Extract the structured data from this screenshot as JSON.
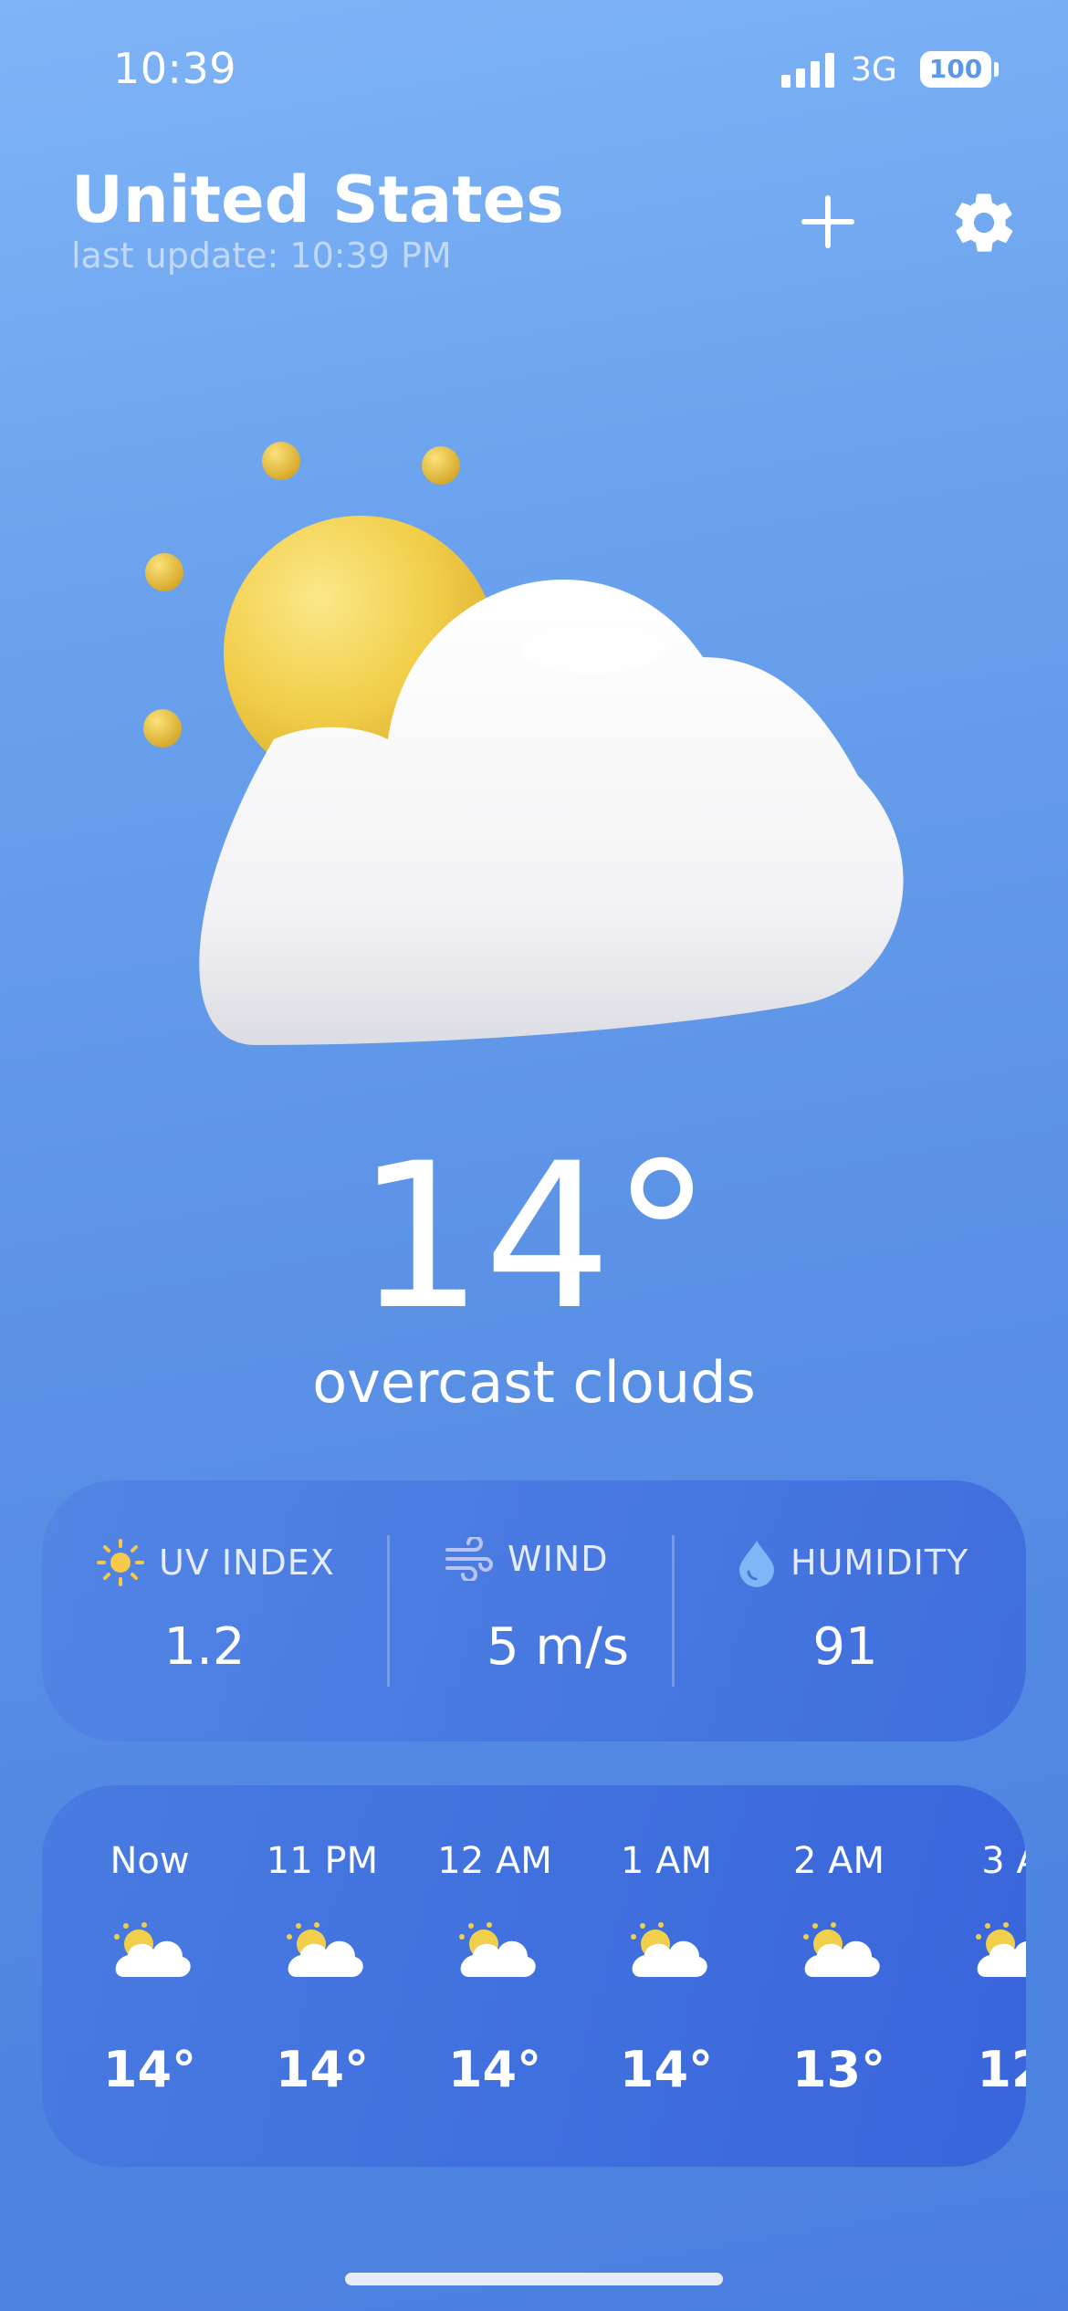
{
  "status_bar": {
    "time": "10:39",
    "network": "3G",
    "battery": "100"
  },
  "header": {
    "location": "United States",
    "last_update": "last update: 10:39 PM",
    "add_icon": "plus-icon",
    "settings_icon": "gear-icon"
  },
  "current": {
    "illustration": "sun-behind-cloud",
    "temperature": "14°",
    "condition": "overcast clouds"
  },
  "stats": [
    {
      "icon": "sun-icon",
      "label": "UV INDEX",
      "value": "1.2"
    },
    {
      "icon": "wind-icon",
      "label": "WIND",
      "value": "5 m/s"
    },
    {
      "icon": "drop-icon",
      "label": "HUMIDITY",
      "value": "91"
    }
  ],
  "hourly": [
    {
      "time": "Now",
      "icon": "partly-cloudy-icon",
      "temp": "14°"
    },
    {
      "time": "11 PM",
      "icon": "partly-cloudy-icon",
      "temp": "14°"
    },
    {
      "time": "12 AM",
      "icon": "partly-cloudy-icon",
      "temp": "14°"
    },
    {
      "time": "1 AM",
      "icon": "partly-cloudy-icon",
      "temp": "14°"
    },
    {
      "time": "2 AM",
      "icon": "partly-cloudy-icon",
      "temp": "13°"
    },
    {
      "time": "3 A",
      "icon": "partly-cloudy-icon",
      "temp": "12"
    }
  ],
  "colors": {
    "background_top": "#7fb4f6",
    "background_bottom": "#4a7fdf",
    "sun": "#f2cf4a",
    "cloud": "#ffffff",
    "uv_icon": "#f7c948",
    "wind_icon": "#b8c4f0",
    "humidity_icon": "#7fb6f5"
  }
}
